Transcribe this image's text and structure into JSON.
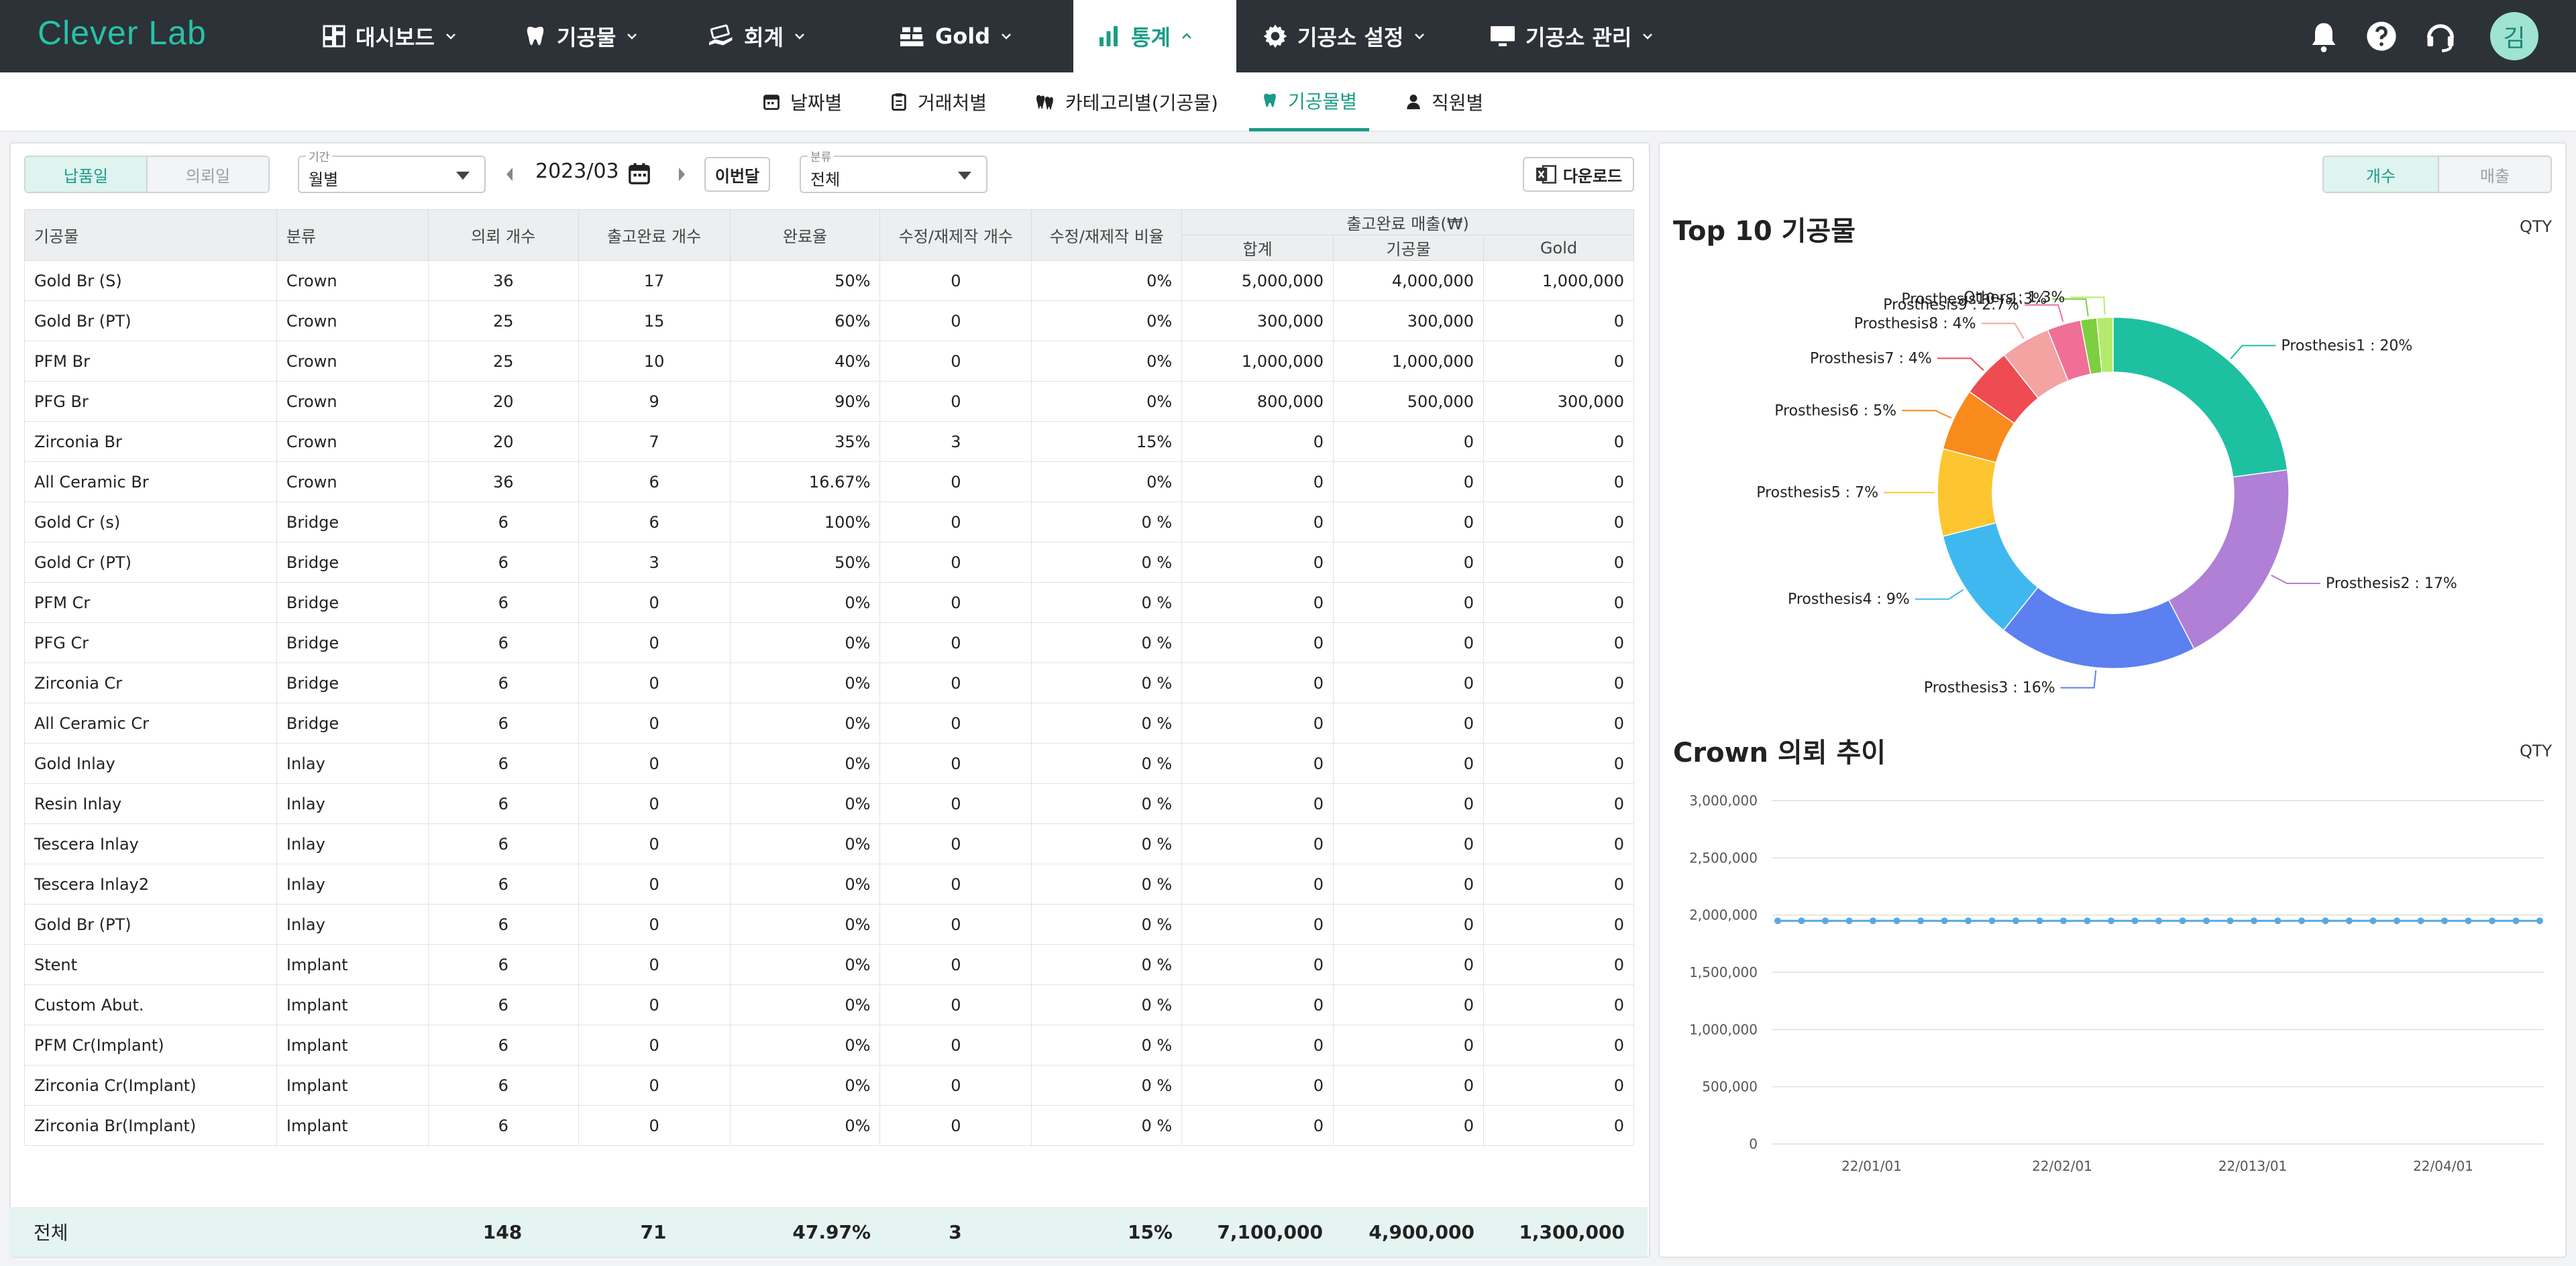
{
  "app": {
    "logo": "Clever Lab",
    "avatar": "김"
  },
  "nav": [
    {
      "label": "대시보드"
    },
    {
      "label": "기공물"
    },
    {
      "label": "회계"
    },
    {
      "label": "Gold"
    },
    {
      "label": "통계"
    },
    {
      "label": "기공소 설정"
    },
    {
      "label": "기공소 관리"
    }
  ],
  "subnav": [
    {
      "label": "날짜별"
    },
    {
      "label": "거래처별"
    },
    {
      "label": "카테고리별(기공물)"
    },
    {
      "label": "기공물별"
    },
    {
      "label": "직원별"
    }
  ],
  "filters": {
    "date_type": [
      "납품일",
      "의뢰일"
    ],
    "period_legend": "기간",
    "period_value": "월별",
    "month": "2023/03",
    "this_month": "이번달",
    "category_legend": "분류",
    "category_value": "전체",
    "download": "다운로드"
  },
  "table": {
    "headers": {
      "name": "기공물",
      "cat": "분류",
      "req": "의뢰 개수",
      "done": "출고완료 개수",
      "rate": "완료율",
      "rework": "수정/재제작 개수",
      "rework_rate": "수정/재제작 비율",
      "sales_group": "출고완료 매출(₩)",
      "total": "합계",
      "product": "기공물",
      "gold": "Gold"
    },
    "rows": [
      [
        "Gold Br (S)",
        "Crown",
        "36",
        "17",
        "50%",
        "0",
        "0%",
        "5,000,000",
        "4,000,000",
        "1,000,000"
      ],
      [
        "Gold Br (PT)",
        "Crown",
        "25",
        "15",
        "60%",
        "0",
        "0%",
        "300,000",
        "300,000",
        "0"
      ],
      [
        "PFM Br",
        "Crown",
        "25",
        "10",
        "40%",
        "0",
        "0%",
        "1,000,000",
        "1,000,000",
        "0"
      ],
      [
        "PFG Br",
        "Crown",
        "20",
        "9",
        "90%",
        "0",
        "0%",
        "800,000",
        "500,000",
        "300,000"
      ],
      [
        "Zirconia Br",
        "Crown",
        "20",
        "7",
        "35%",
        "3",
        "15%",
        "0",
        "0",
        "0"
      ],
      [
        "All Ceramic Br",
        "Crown",
        "36",
        "6",
        "16.67%",
        "0",
        "0%",
        "0",
        "0",
        "0"
      ],
      [
        "Gold Cr (s)",
        "Bridge",
        "6",
        "6",
        "100%",
        "0",
        "0 %",
        "0",
        "0",
        "0"
      ],
      [
        "Gold Cr (PT)",
        "Bridge",
        "6",
        "3",
        "50%",
        "0",
        "0 %",
        "0",
        "0",
        "0"
      ],
      [
        "PFM Cr",
        "Bridge",
        "6",
        "0",
        "0%",
        "0",
        "0 %",
        "0",
        "0",
        "0"
      ],
      [
        "PFG Cr",
        "Bridge",
        "6",
        "0",
        "0%",
        "0",
        "0 %",
        "0",
        "0",
        "0"
      ],
      [
        "Zirconia Cr",
        "Bridge",
        "6",
        "0",
        "0%",
        "0",
        "0 %",
        "0",
        "0",
        "0"
      ],
      [
        "All Ceramic Cr",
        "Bridge",
        "6",
        "0",
        "0%",
        "0",
        "0 %",
        "0",
        "0",
        "0"
      ],
      [
        "Gold Inlay",
        "Inlay",
        "6",
        "0",
        "0%",
        "0",
        "0 %",
        "0",
        "0",
        "0"
      ],
      [
        "Resin Inlay",
        "Inlay",
        "6",
        "0",
        "0%",
        "0",
        "0 %",
        "0",
        "0",
        "0"
      ],
      [
        "Tescera Inlay",
        "Inlay",
        "6",
        "0",
        "0%",
        "0",
        "0 %",
        "0",
        "0",
        "0"
      ],
      [
        "Tescera Inlay2",
        "Inlay",
        "6",
        "0",
        "0%",
        "0",
        "0 %",
        "0",
        "0",
        "0"
      ],
      [
        "Gold Br (PT)",
        "Inlay",
        "6",
        "0",
        "0%",
        "0",
        "0 %",
        "0",
        "0",
        "0"
      ],
      [
        "Stent",
        "Implant",
        "6",
        "0",
        "0%",
        "0",
        "0 %",
        "0",
        "0",
        "0"
      ],
      [
        "Custom Abut.",
        "Implant",
        "6",
        "0",
        "0%",
        "0",
        "0 %",
        "0",
        "0",
        "0"
      ],
      [
        "PFM Cr(Implant)",
        "Implant",
        "6",
        "0",
        "0%",
        "0",
        "0 %",
        "0",
        "0",
        "0"
      ],
      [
        "Zirconia Cr(Implant)",
        "Implant",
        "6",
        "0",
        "0%",
        "0",
        "0 %",
        "0",
        "0",
        "0"
      ],
      [
        "Zirconia Br(Implant)",
        "Implant",
        "6",
        "0",
        "0%",
        "0",
        "0 %",
        "0",
        "0",
        "0"
      ]
    ],
    "total": {
      "label": "전체",
      "req": "148",
      "done": "71",
      "rate": "47.97%",
      "rework": "3",
      "rework_rate": "15%",
      "total": "7,100,000",
      "product": "4,900,000",
      "gold": "1,300,000"
    }
  },
  "right": {
    "toggle": [
      "개수",
      "매출"
    ],
    "qty": "QTY"
  },
  "chart_data": [
    {
      "type": "pie",
      "title": "Top 10 기공물",
      "unit": "QTY",
      "slices": [
        {
          "label": "Prosthesis1",
          "value": 20,
          "color": "#1ec0a2"
        },
        {
          "label": "Prosthesis2",
          "value": 17,
          "color": "#b07fd6"
        },
        {
          "label": "Prosthesis3",
          "value": 16,
          "color": "#5c80f0"
        },
        {
          "label": "Prosthesis4",
          "value": 9,
          "color": "#3fb8f0"
        },
        {
          "label": "Prosthesis5",
          "value": 7,
          "color": "#fdc630"
        },
        {
          "label": "Prosthesis6",
          "value": 5,
          "color": "#f98a1c"
        },
        {
          "label": "Prosthesis7",
          "value": 4,
          "color": "#ef4b52"
        },
        {
          "label": "Prosthesis8",
          "value": 4,
          "color": "#f4a3a3"
        },
        {
          "label": "Prosthesis9",
          "value": 2.7,
          "color": "#ef6f97"
        },
        {
          "label": "Prosthesis10",
          "value": 1.3,
          "color": "#7ccf3f"
        },
        {
          "label": "Others",
          "value": 1.3,
          "color": "#b5eb6c"
        }
      ]
    },
    {
      "type": "line",
      "title": "Crown 의뢰 추이",
      "unit": "QTY",
      "x_ticks": [
        "22/01/01",
        "22/02/01",
        "22/013/01",
        "22/04/01"
      ],
      "y_ticks": [
        "0",
        "500,000",
        "1,000,000",
        "1,500,000",
        "2,000,000",
        "2,500,000",
        "3,000,000"
      ],
      "ylim": [
        0,
        3000000
      ],
      "series": [
        {
          "color": "#5aa8e0",
          "values": [
            1950000,
            1950000,
            1950000,
            1950000,
            1950000,
            1950000,
            1950000,
            1950000,
            1950000,
            1950000,
            1950000,
            1950000,
            1950000,
            1950000,
            1950000,
            1950000,
            1950000,
            1950000,
            1950000,
            1950000,
            1950000,
            1950000,
            1950000,
            1950000,
            1950000,
            1950000,
            1950000,
            1950000,
            1950000,
            1950000,
            1950000,
            1950000,
            1950000
          ]
        }
      ]
    }
  ]
}
